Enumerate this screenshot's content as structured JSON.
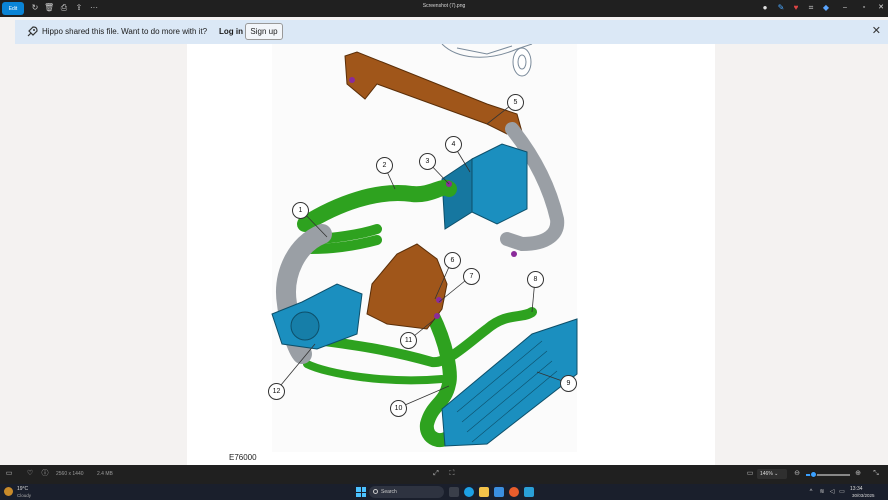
{
  "titlebar": {
    "edit_label": "Edit",
    "file_name": "Screenshot (7).png",
    "left_icons": [
      "rotate-icon",
      "delete-icon",
      "print-icon",
      "share-icon",
      "more-icon"
    ],
    "right_icons": [
      "person-icon",
      "edit-pen-icon",
      "heart-icon",
      "crop-icon",
      "car-icon"
    ]
  },
  "banner": {
    "message": "Hippo shared this file. Want to do more with it?",
    "login_label": "Log in",
    "signup_label": "Sign up"
  },
  "diagram": {
    "figure_code": "E76000",
    "callouts": [
      "1",
      "2",
      "3",
      "4",
      "5",
      "6",
      "7",
      "8",
      "9",
      "10",
      "11",
      "12"
    ]
  },
  "statusbar": {
    "dimensions": "2560 x 1440",
    "file_size": "2.4 MB",
    "zoom_value": "146%",
    "zoom_fraction": 0.16
  },
  "taskbar": {
    "temperature": "19°C",
    "weather": "Cloudy",
    "search_placeholder": "Search",
    "time": "13:34",
    "date": "30/03/2025"
  },
  "colors": {
    "accent": "#0a84d6",
    "banner_bg": "#dbe8f6",
    "hose_green": "#2ea21f",
    "intercooler_blue": "#1b8fbf",
    "bracket_brown": "#a0561a"
  }
}
